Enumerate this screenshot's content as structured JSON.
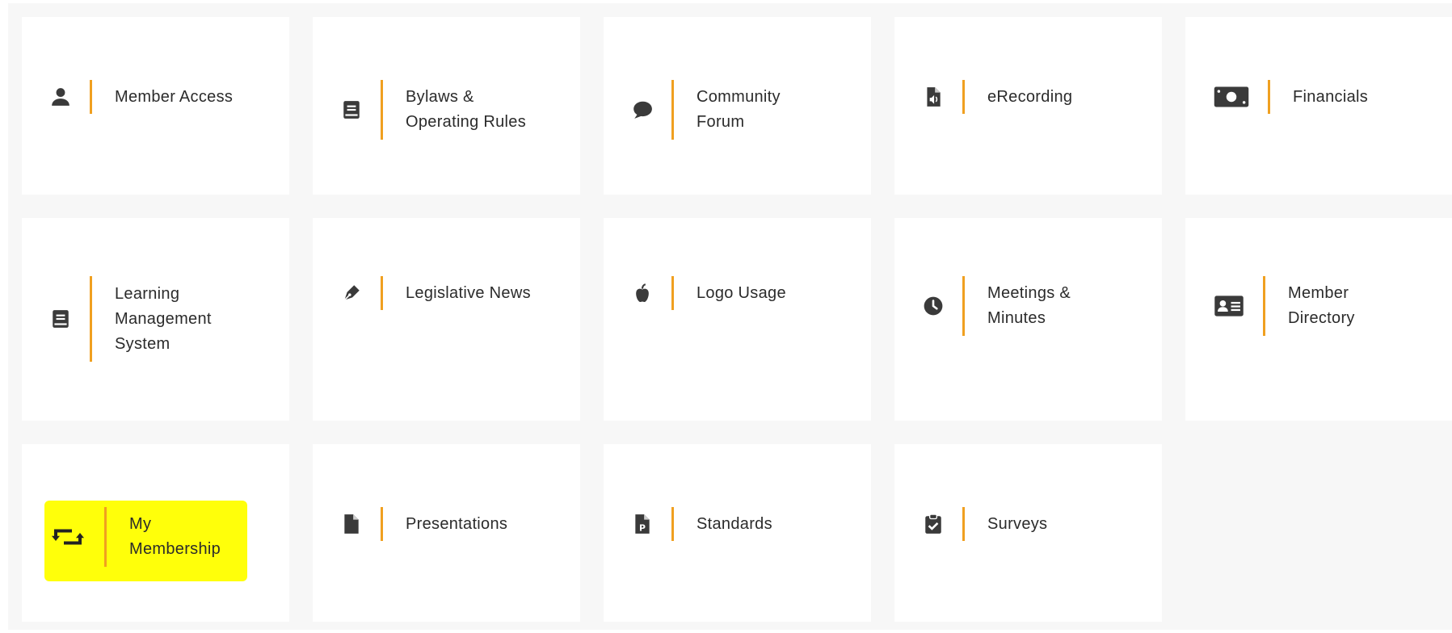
{
  "tiles": [
    {
      "label": "Member Access",
      "icon": "user-icon"
    },
    {
      "label": "Bylaws & Operating Rules",
      "icon": "book-icon"
    },
    {
      "label": "Community Forum",
      "icon": "comment-icon"
    },
    {
      "label": "eRecording",
      "icon": "audio-file-icon"
    },
    {
      "label": "Financials",
      "icon": "money-bill-icon"
    },
    {
      "label": "Learning Management System",
      "icon": "book-icon"
    },
    {
      "label": "Legislative News",
      "icon": "pen-icon"
    },
    {
      "label": "Logo Usage",
      "icon": "apple-icon"
    },
    {
      "label": "Meetings & Minutes",
      "icon": "clock-icon"
    },
    {
      "label": "Member Directory",
      "icon": "id-card-icon"
    },
    {
      "label": "My Membership",
      "icon": "retweet-icon"
    },
    {
      "label": "Presentations",
      "icon": "file-icon"
    },
    {
      "label": "Standards",
      "icon": "file-p-icon"
    },
    {
      "label": "Surveys",
      "icon": "clipboard-check-icon"
    }
  ],
  "colors": {
    "accent": "#f0a020",
    "highlight": "#ffff0a",
    "background": "#f7f7f7",
    "tile": "#ffffff",
    "icon": "#3a3a3a"
  }
}
